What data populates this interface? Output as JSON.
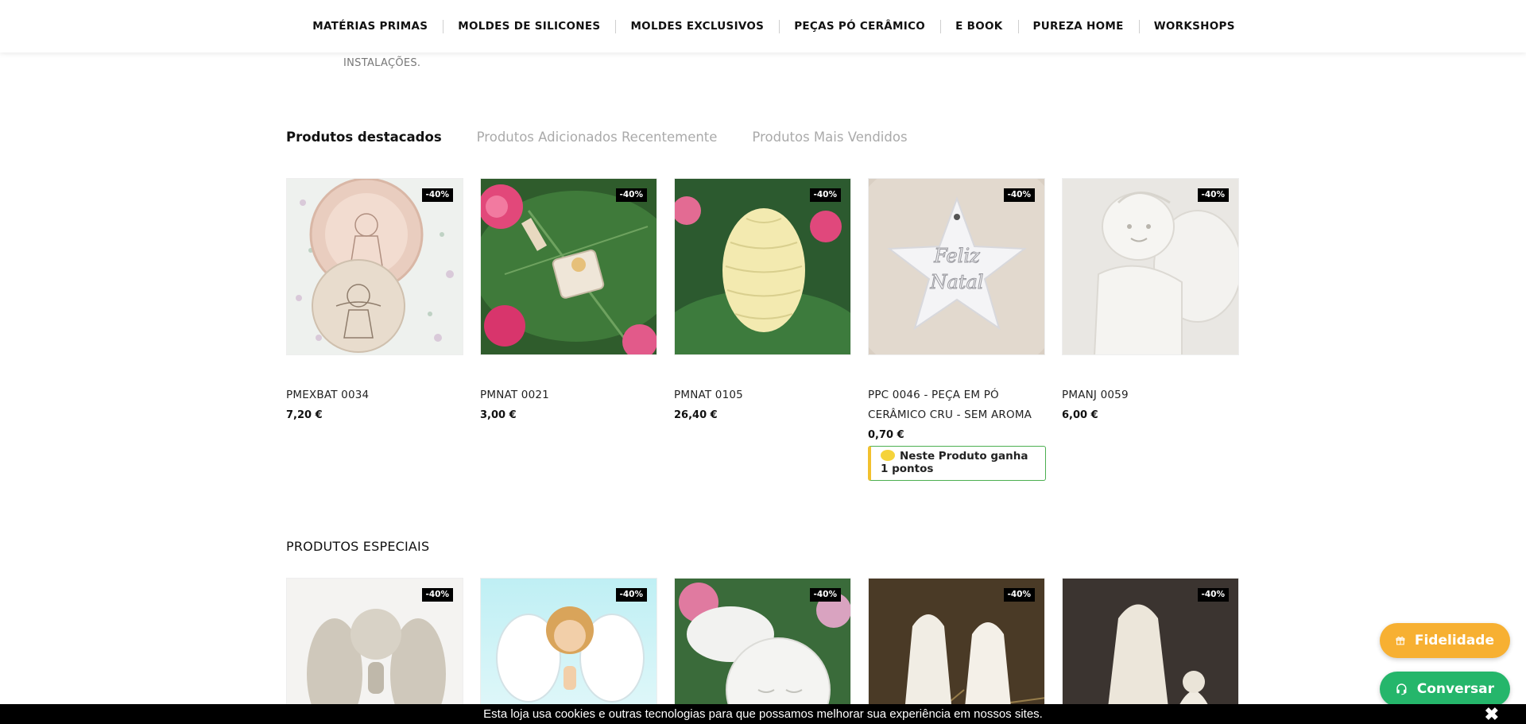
{
  "nav": {
    "items": [
      "MATÉRIAS PRIMAS",
      "MOLDES DE SILICONES",
      "MOLDES EXCLUSIVOS",
      "PEÇAS PÓ CERÂMICO",
      "E BOOK",
      "PUREZA HOME",
      "WORKSHOPS"
    ]
  },
  "intro": {
    "install_text": "INSTALAÇÕES."
  },
  "tabs": {
    "featured": "Produtos destacados",
    "recent": "Produtos Adicionados Recentemente",
    "bestsellers": "Produtos Mais Vendidos"
  },
  "featured_products": [
    {
      "name": "PMEXBAT 0034",
      "price": "7,20 €",
      "badge": "-40%"
    },
    {
      "name": "PMNAT 0021",
      "price": "3,00 €",
      "badge": "-40%"
    },
    {
      "name": "PMNAT 0105",
      "price": "26,40 €",
      "badge": "-40%"
    },
    {
      "name": "PPC 0046 - PEÇA EM PÓ CERÂMICO CRU - SEM AROMA",
      "price": "0,70 €",
      "badge": "-40%",
      "points": "Neste Produto ganha 1 pontos"
    },
    {
      "name": "PMANJ 0059",
      "price": "6,00 €",
      "badge": "-40%"
    }
  ],
  "special": {
    "title": "PRODUTOS ESPECIAIS",
    "badges": [
      "-40%",
      "-40%",
      "-40%",
      "-40%",
      "-40%"
    ]
  },
  "floating": {
    "loyalty": "Fidelidade",
    "chat": "Conversar"
  },
  "cookie": {
    "text": "Esta loja usa cookies e outras tecnologias para que possamos melhorar sua experiência em nossos sites.",
    "close": "✖"
  },
  "colors": {
    "loyalty": "#f7b032",
    "chat": "#25b66b",
    "badge": "#000000",
    "points_border": "#4caf50",
    "points_accent": "#f2c12e"
  }
}
